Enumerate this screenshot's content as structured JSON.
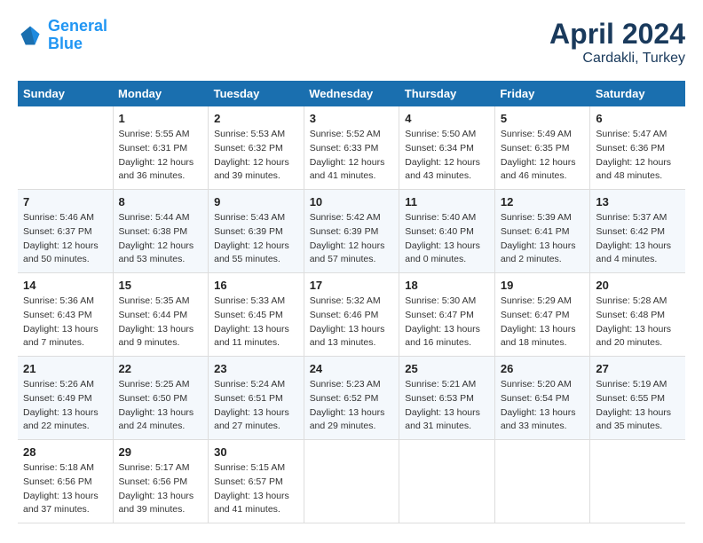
{
  "header": {
    "logo_line1": "General",
    "logo_line2": "Blue",
    "title": "April 2024",
    "subtitle": "Cardakli, Turkey"
  },
  "calendar": {
    "days_of_week": [
      "Sunday",
      "Monday",
      "Tuesday",
      "Wednesday",
      "Thursday",
      "Friday",
      "Saturday"
    ],
    "weeks": [
      [
        {
          "day": "",
          "info": ""
        },
        {
          "day": "1",
          "info": "Sunrise: 5:55 AM\nSunset: 6:31 PM\nDaylight: 12 hours\nand 36 minutes."
        },
        {
          "day": "2",
          "info": "Sunrise: 5:53 AM\nSunset: 6:32 PM\nDaylight: 12 hours\nand 39 minutes."
        },
        {
          "day": "3",
          "info": "Sunrise: 5:52 AM\nSunset: 6:33 PM\nDaylight: 12 hours\nand 41 minutes."
        },
        {
          "day": "4",
          "info": "Sunrise: 5:50 AM\nSunset: 6:34 PM\nDaylight: 12 hours\nand 43 minutes."
        },
        {
          "day": "5",
          "info": "Sunrise: 5:49 AM\nSunset: 6:35 PM\nDaylight: 12 hours\nand 46 minutes."
        },
        {
          "day": "6",
          "info": "Sunrise: 5:47 AM\nSunset: 6:36 PM\nDaylight: 12 hours\nand 48 minutes."
        }
      ],
      [
        {
          "day": "7",
          "info": "Sunrise: 5:46 AM\nSunset: 6:37 PM\nDaylight: 12 hours\nand 50 minutes."
        },
        {
          "day": "8",
          "info": "Sunrise: 5:44 AM\nSunset: 6:38 PM\nDaylight: 12 hours\nand 53 minutes."
        },
        {
          "day": "9",
          "info": "Sunrise: 5:43 AM\nSunset: 6:39 PM\nDaylight: 12 hours\nand 55 minutes."
        },
        {
          "day": "10",
          "info": "Sunrise: 5:42 AM\nSunset: 6:39 PM\nDaylight: 12 hours\nand 57 minutes."
        },
        {
          "day": "11",
          "info": "Sunrise: 5:40 AM\nSunset: 6:40 PM\nDaylight: 13 hours\nand 0 minutes."
        },
        {
          "day": "12",
          "info": "Sunrise: 5:39 AM\nSunset: 6:41 PM\nDaylight: 13 hours\nand 2 minutes."
        },
        {
          "day": "13",
          "info": "Sunrise: 5:37 AM\nSunset: 6:42 PM\nDaylight: 13 hours\nand 4 minutes."
        }
      ],
      [
        {
          "day": "14",
          "info": "Sunrise: 5:36 AM\nSunset: 6:43 PM\nDaylight: 13 hours\nand 7 minutes."
        },
        {
          "day": "15",
          "info": "Sunrise: 5:35 AM\nSunset: 6:44 PM\nDaylight: 13 hours\nand 9 minutes."
        },
        {
          "day": "16",
          "info": "Sunrise: 5:33 AM\nSunset: 6:45 PM\nDaylight: 13 hours\nand 11 minutes."
        },
        {
          "day": "17",
          "info": "Sunrise: 5:32 AM\nSunset: 6:46 PM\nDaylight: 13 hours\nand 13 minutes."
        },
        {
          "day": "18",
          "info": "Sunrise: 5:30 AM\nSunset: 6:47 PM\nDaylight: 13 hours\nand 16 minutes."
        },
        {
          "day": "19",
          "info": "Sunrise: 5:29 AM\nSunset: 6:47 PM\nDaylight: 13 hours\nand 18 minutes."
        },
        {
          "day": "20",
          "info": "Sunrise: 5:28 AM\nSunset: 6:48 PM\nDaylight: 13 hours\nand 20 minutes."
        }
      ],
      [
        {
          "day": "21",
          "info": "Sunrise: 5:26 AM\nSunset: 6:49 PM\nDaylight: 13 hours\nand 22 minutes."
        },
        {
          "day": "22",
          "info": "Sunrise: 5:25 AM\nSunset: 6:50 PM\nDaylight: 13 hours\nand 24 minutes."
        },
        {
          "day": "23",
          "info": "Sunrise: 5:24 AM\nSunset: 6:51 PM\nDaylight: 13 hours\nand 27 minutes."
        },
        {
          "day": "24",
          "info": "Sunrise: 5:23 AM\nSunset: 6:52 PM\nDaylight: 13 hours\nand 29 minutes."
        },
        {
          "day": "25",
          "info": "Sunrise: 5:21 AM\nSunset: 6:53 PM\nDaylight: 13 hours\nand 31 minutes."
        },
        {
          "day": "26",
          "info": "Sunrise: 5:20 AM\nSunset: 6:54 PM\nDaylight: 13 hours\nand 33 minutes."
        },
        {
          "day": "27",
          "info": "Sunrise: 5:19 AM\nSunset: 6:55 PM\nDaylight: 13 hours\nand 35 minutes."
        }
      ],
      [
        {
          "day": "28",
          "info": "Sunrise: 5:18 AM\nSunset: 6:56 PM\nDaylight: 13 hours\nand 37 minutes."
        },
        {
          "day": "29",
          "info": "Sunrise: 5:17 AM\nSunset: 6:56 PM\nDaylight: 13 hours\nand 39 minutes."
        },
        {
          "day": "30",
          "info": "Sunrise: 5:15 AM\nSunset: 6:57 PM\nDaylight: 13 hours\nand 41 minutes."
        },
        {
          "day": "",
          "info": ""
        },
        {
          "day": "",
          "info": ""
        },
        {
          "day": "",
          "info": ""
        },
        {
          "day": "",
          "info": ""
        }
      ]
    ]
  }
}
